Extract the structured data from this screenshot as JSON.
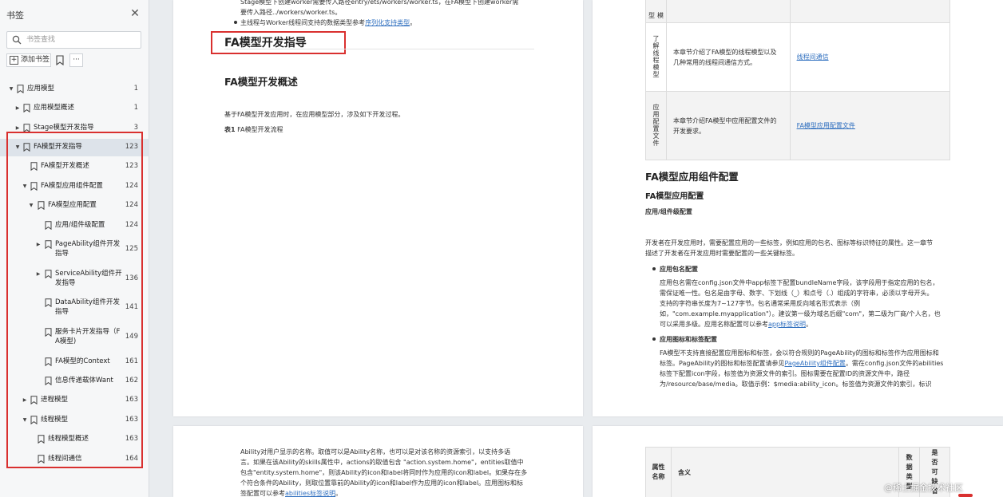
{
  "sidebar": {
    "title": "书签",
    "close_glyph": "✕",
    "search_placeholder": "书签查找",
    "add_bookmark_label": "添加书签",
    "more_label": "···",
    "items": [
      {
        "label": "应用模型",
        "page": "1",
        "level": 0,
        "twisty": "down"
      },
      {
        "label": "应用模型概述",
        "page": "1",
        "level": 1,
        "twisty": "right"
      },
      {
        "label": "Stage模型开发指导",
        "page": "3",
        "level": 1,
        "twisty": "right"
      },
      {
        "label": "FA模型开发指导",
        "page": "123",
        "level": 1,
        "twisty": "down",
        "active": true
      },
      {
        "label": "FA模型开发概述",
        "page": "123",
        "level": 2,
        "twisty": ""
      },
      {
        "label": "FA模型应用组件配置",
        "page": "124",
        "level": 2,
        "twisty": "down"
      },
      {
        "label": "FA模型应用配置",
        "page": "124",
        "level": 3,
        "twisty": "down"
      },
      {
        "label": "应用/组件级配置",
        "page": "124",
        "level": 4,
        "twisty": ""
      },
      {
        "label": "PageAbility组件开发",
        "label2": "指导",
        "page": "125",
        "level": 4,
        "twisty": "right"
      },
      {
        "label": "ServiceAbility组件开",
        "label2": "发指导",
        "page": "136",
        "level": 4,
        "twisty": "right"
      },
      {
        "label": "DataAbility组件开发",
        "label2": "指导",
        "page": "141",
        "level": 4,
        "twisty": ""
      },
      {
        "label": "服务卡片开发指导（F",
        "label2": "A模型)",
        "page": "149",
        "level": 4,
        "twisty": ""
      },
      {
        "label": "FA模型的Context",
        "page": "161",
        "level": 4,
        "twisty": ""
      },
      {
        "label": "信息传递载体Want",
        "page": "162",
        "level": 4,
        "twisty": ""
      },
      {
        "label": "进程模型",
        "page": "163",
        "level": 2,
        "twisty": "right"
      },
      {
        "label": "线程模型",
        "page": "163",
        "level": 2,
        "twisty": "down"
      },
      {
        "label": "线程模型概述",
        "page": "163",
        "level": 3,
        "twisty": ""
      },
      {
        "label": "线程间通信",
        "page": "164",
        "level": 3,
        "twisty": ""
      }
    ]
  },
  "page1": {
    "top_line1": "Stage模型下创建worker需要传入路径entry/ets/workers/worker.ts，在FA模型下创建worker需",
    "top_line2": "要传入路径../workers/worker.ts。",
    "top_bullet_text": "主线程与Worker线程间支持的数据类型参考",
    "top_bullet_link": "序列化支持类型",
    "top_bullet_end": "。",
    "heading": "FA模型开发指导",
    "subheading": "FA模型开发概述",
    "intro": "基于FA模型开发应用时，在应用模型部分，涉及如下开发过程。",
    "table_caption_bold": "表1",
    "table_caption_text": " FA模型开发流程"
  },
  "page2": {
    "row_top_cell": "模型",
    "rows": [
      {
        "task": "了解线程模型",
        "desc_line1": "本章节介绍了FA模型的线程模型以及",
        "desc_line2": "几种常用的线程间通信方式。",
        "link": "线程间通信"
      },
      {
        "task": "应用配置文件",
        "desc_line1": "本章节介绍FA模型中应用配置文件的",
        "desc_line2": "开发要求。",
        "link": "FA模型应用配置文件"
      }
    ],
    "h1": "FA模型应用组件配置",
    "h2": "FA模型应用配置",
    "h3": "应用/组件级配置",
    "para1": "开发者在开发应用时，需要配置应用的一些标签，例如应用的包名、图标等标识特征的属性。这一章节",
    "para2": "描述了开发者在开发应用时需要配置的一些关键标签。",
    "bullet1_title": "应用包名配置",
    "bullet1_lines": [
      "应用包名需在config.json文件中app标签下配置bundleName字段，该字段用于指定应用的包名，",
      "需保证唯一性。包名是由字母、数字、下划线（_）和点号（.）组成的字符串，必须以字母开头。",
      "支持的字符串长度为7~127字节。包名通常采用反向域名形式表示（例",
      "如，\"com.example.myapplication\"）。建议第一级为域名后缀\"com\"，第二级为厂商/个人名，也"
    ],
    "bullet1_last": "可以采用多级。应用名称配置可以参考",
    "bullet1_link": "app标签说明",
    "bullet1_end": "。",
    "bullet2_title": "应用图标和标签配置",
    "bullet2_line1": "FA模型不支持直接配置应用图标和标签，会以符合规则的PageAbility的图标和标签作为应用图标和",
    "bullet2_line2a": "标签。PageAbility的图标和标签配置请参见",
    "bullet2_line2_link": "PageAbility组件配置",
    "bullet2_line2b": "。需在config.json文件的abilities",
    "bullet2_line3": "标签下配置icon字段，标签值为资源文件的索引。图标需要在配置ID的资源文件中，路径",
    "bullet2_line4": "为/resource/base/media。取值示例：$media:ability_icon。标签值为资源文件的索引，标识"
  },
  "page3": {
    "line1": "Ability对用户显示的名称。取值可以是Ability名称，也可以是对该名称的资源索引，以支持多语",
    "line2": "言。如果在该Ability的skills属性中，actions的取值包含 \"action.system.home\"，entities取值中",
    "line3": "包含\"entity.system.home\"，则该Ability的icon和label将同时作为应用的icon和label。如果存在多",
    "line4": "个符合条件的Ability，则取位置靠前的Ability的icon和label作为应用的icon和label。应用图标和标",
    "line5a": "签配置可以参考",
    "line5_link": "abilities标签说明",
    "line5_end": "。"
  },
  "page4": {
    "col_attr": "属性名称",
    "col_meaning": "含义",
    "col_type": "数据类型",
    "col_optional": "是否可缺省"
  },
  "watermark": "@稀土掘金技术社区"
}
